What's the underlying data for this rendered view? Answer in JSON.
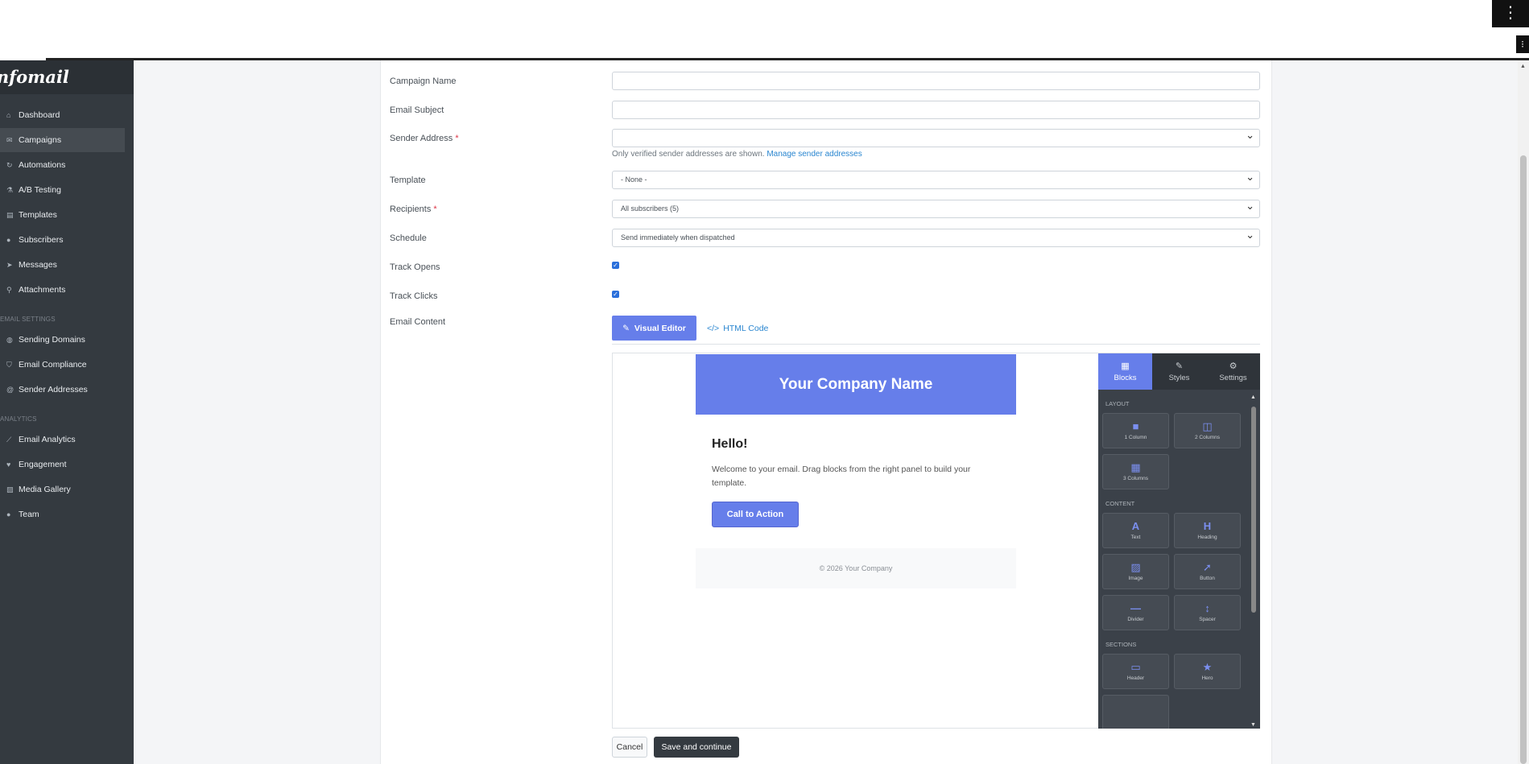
{
  "app": {
    "brand": "Infomail"
  },
  "sidebar": {
    "items": [
      {
        "label": "Dashboard",
        "icon": "home-icon"
      },
      {
        "label": "Campaigns",
        "icon": "envelope-icon",
        "active": true
      },
      {
        "label": "Automations",
        "icon": "sync-icon"
      },
      {
        "label": "A/B Testing",
        "icon": "flask-icon"
      },
      {
        "label": "Templates",
        "icon": "file-icon"
      },
      {
        "label": "Subscribers",
        "icon": "users-icon"
      },
      {
        "label": "Messages",
        "icon": "paper-plane-icon"
      },
      {
        "label": "Attachments",
        "icon": "paperclip-icon"
      }
    ],
    "email_settings_heading": "EMAIL SETTINGS",
    "email_settings": [
      {
        "label": "Sending Domains",
        "icon": "globe-icon"
      },
      {
        "label": "Email Compliance",
        "icon": "shield-icon"
      },
      {
        "label": "Sender Addresses",
        "icon": "at-icon"
      }
    ],
    "analytics_heading": "ANALYTICS",
    "analytics": [
      {
        "label": "Email Analytics",
        "icon": "chart-line-icon"
      },
      {
        "label": "Engagement",
        "icon": "heart-icon"
      },
      {
        "label": "Media Gallery",
        "icon": "images-icon"
      },
      {
        "label": "Team",
        "icon": "team-icon"
      }
    ]
  },
  "form": {
    "campaign_name": {
      "label": "Campaign Name",
      "value": ""
    },
    "email_subject": {
      "label": "Email Subject",
      "value": ""
    },
    "sender_address": {
      "label": "Sender Address",
      "required": "*",
      "value": "",
      "help": "Only verified sender addresses are shown.",
      "help_link": "Manage sender addresses"
    },
    "template": {
      "label": "Template",
      "value": "- None -"
    },
    "recipients": {
      "label": "Recipients",
      "required": "*",
      "value": "All subscribers (5)"
    },
    "schedule": {
      "label": "Schedule",
      "value": "Send immediately when dispatched"
    },
    "track_opens": {
      "label": "Track Opens",
      "checked": true
    },
    "track_clicks": {
      "label": "Track Clicks",
      "checked": true
    },
    "email_content": {
      "label": "Email Content"
    }
  },
  "content_tabs": {
    "visual": "Visual Editor",
    "html": "HTML Code"
  },
  "email_preview": {
    "header": "Your Company Name",
    "greeting": "Hello!",
    "body": "Welcome to your email. Drag blocks from the right panel to build your template.",
    "cta": "Call to Action",
    "footer": "© 2026 Your Company"
  },
  "blocks_panel": {
    "tabs": [
      {
        "label": "Blocks",
        "icon": "grid-icon"
      },
      {
        "label": "Styles",
        "icon": "brush-icon"
      },
      {
        "label": "Settings",
        "icon": "gear-icon"
      }
    ],
    "layout_heading": "LAYOUT",
    "layout": [
      "1 Column",
      "2 Columns",
      "3 Columns"
    ],
    "content_heading": "CONTENT",
    "content": [
      "Text",
      "Heading",
      "Image",
      "Button",
      "Divider",
      "Spacer"
    ],
    "sections_heading": "SECTIONS",
    "sections": [
      "Header",
      "Hero"
    ]
  },
  "actions": {
    "cancel": "Cancel",
    "save": "Save and continue"
  },
  "colors": {
    "accent": "#667eea",
    "sidebar": "#343a40"
  }
}
